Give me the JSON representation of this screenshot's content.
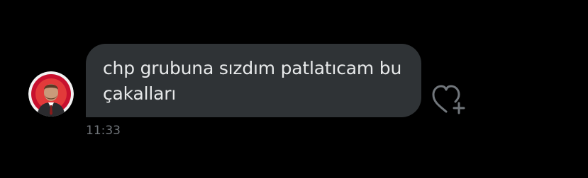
{
  "message": {
    "text": "chp grubuna sızdım patlatıcam bu\nçakalları",
    "time": "11:33"
  },
  "icons": {
    "avatar": "user-avatar",
    "reaction": "heart-plus-icon"
  },
  "colors": {
    "background": "#000000",
    "bubble": "#2f3336",
    "text": "#e7e9ea",
    "muted": "#71767b",
    "avatar_accent": "#c8102e"
  }
}
